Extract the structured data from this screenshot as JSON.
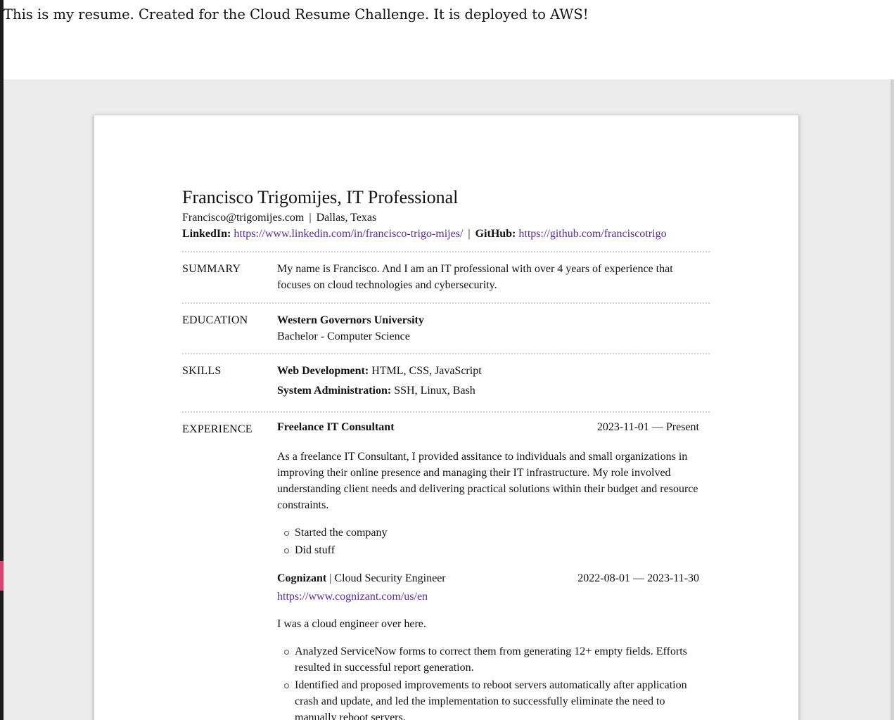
{
  "banner": "This is my resume. Created for the Cloud Resume Challenge. It is deployed to AWS!",
  "header": {
    "name": "Francisco Trigomijes, IT Professional",
    "email": "Francisco@trigomijes.com",
    "separator": "|",
    "location": "Dallas, Texas",
    "linkedin_label": "LinkedIn:",
    "linkedin_url": "https://www.linkedin.com/in/francisco-trigo-mijes/",
    "github_label": "GitHub:",
    "github_url": "https://github.com/franciscotrigo"
  },
  "summary": {
    "label": "SUMMARY",
    "text": "My name is Francisco. And I am an IT professional with over 4 years of experience that focuses on cloud technologies and cybersecurity."
  },
  "education": {
    "label": "EDUCATION",
    "school": "Western Governors University",
    "degree": "Bachelor - Computer Science"
  },
  "skills": {
    "label": "SKILLS",
    "items": [
      {
        "category": "Web Development:",
        "list": "HTML, CSS, JavaScript"
      },
      {
        "category": "System Administration:",
        "list": "SSH, Linux, Bash"
      }
    ]
  },
  "experience": {
    "label": "EXPERIENCE",
    "jobs": [
      {
        "title": "Freelance IT Consultant",
        "dates": "2023-11-01 — Present",
        "description": "As a freelance IT Consultant, I provided assitance to individuals and small organizations in improving their online presence and managing their IT infrastructure. My role involved understanding client needs and delivering practical solutions within their budget and resource constraints.",
        "bullets": [
          "Started the company",
          "Did stuff"
        ]
      },
      {
        "company": "Cognizant",
        "role": "| Cloud Security Engineer",
        "dates": "2022-08-01 — 2023-11-30",
        "url": "https://www.cognizant.com/us/en",
        "description": "I was a cloud engineer over here.",
        "bullets": [
          "Analyzed ServiceNow forms to correct them from generating 12+ empty fields. Efforts resulted in successful report generation.",
          "Identified and proposed improvements to reboot servers automatically after application crash and update, and led the implementation to successfully eliminate the need to manually reboot servers."
        ]
      }
    ]
  }
}
